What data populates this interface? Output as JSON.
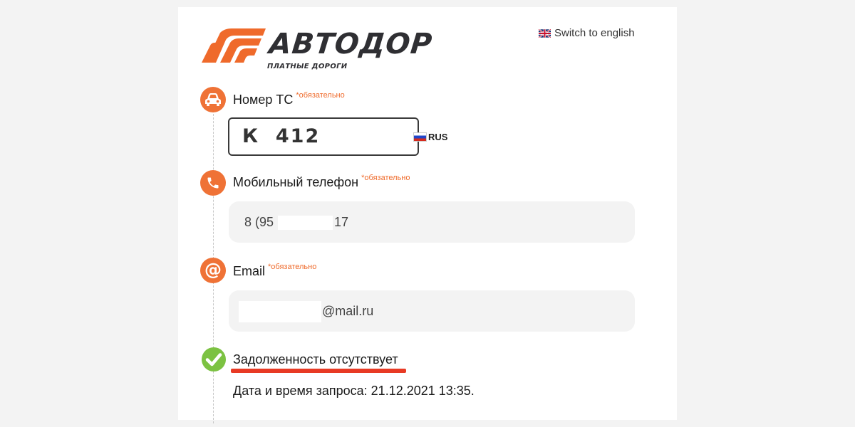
{
  "brand": {
    "name": "АВТОДОР",
    "tagline": "ПЛАТНЫЕ ДОРОГИ",
    "color": "#ef6a2b"
  },
  "language_switch": {
    "label": "Switch to english",
    "icon": "uk-flag-icon"
  },
  "required_label": "*обязательно",
  "vehicle": {
    "label": "Номер ТС",
    "icon": "car-icon",
    "plate_value": "К  412",
    "country_code": "RUS",
    "country_icon": "russia-flag-icon"
  },
  "phone": {
    "label": "Мобильный телефон",
    "icon": "phone-icon",
    "value_start": "8 (95",
    "value_end": "17"
  },
  "email": {
    "label": "Email",
    "icon": "at-sign-icon",
    "value_end": "@mail.ru"
  },
  "result": {
    "icon": "check-circle-icon",
    "status": "Задолженность отсутствует",
    "request_datetime": "Дата и время запроса: 21.12.2021 13:35.",
    "status_color": "#7cc242",
    "underline_color": "#e83a24"
  }
}
